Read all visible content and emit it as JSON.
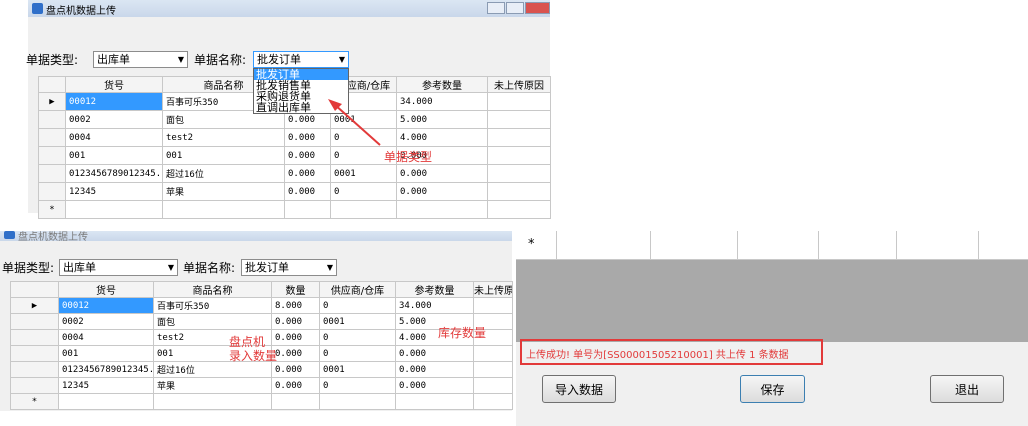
{
  "window": {
    "title": "盘点机数据上传"
  },
  "top": {
    "type_label": "单据类型:",
    "type_value": "出库单",
    "name_label": "单据名称:",
    "name_value": "批发订单",
    "dropdown_options": [
      "批发订单",
      "批发销售单",
      "采购退货单",
      "直调出库单"
    ],
    "headers": [
      "货号",
      "商品名称",
      "",
      "供应商/仓库",
      "参考数量",
      "未上传原因"
    ],
    "rows": [
      [
        "00012",
        "百事可乐350",
        "",
        "",
        "34.000",
        ""
      ],
      [
        "0002",
        "面包",
        "0.000",
        "0001",
        "5.000",
        ""
      ],
      [
        "0004",
        "test2",
        "0.000",
        "0",
        "4.000",
        ""
      ],
      [
        "001",
        "001",
        "0.000",
        "0",
        "0.000",
        ""
      ],
      [
        "0123456789012345...",
        "超过16位",
        "0.000",
        "0001",
        "0.000",
        ""
      ],
      [
        "12345",
        "苹果",
        "0.000",
        "0",
        "0.000",
        ""
      ]
    ],
    "annotation": "单据类型"
  },
  "bottom": {
    "title": "盘点机数据上传",
    "type_label": "单据类型:",
    "type_value": "出库单",
    "name_label": "单据名称:",
    "name_value": "批发订单",
    "headers": [
      "货号",
      "商品名称",
      "数量",
      "供应商/仓库",
      "参考数量",
      "未上传原"
    ],
    "rows": [
      [
        "00012",
        "百事可乐350",
        "8.000",
        "0",
        "34.000",
        ""
      ],
      [
        "0002",
        "面包",
        "0.000",
        "0001",
        "5.000",
        ""
      ],
      [
        "0004",
        "test2",
        "0.000",
        "0",
        "4.000",
        ""
      ],
      [
        "001",
        "001",
        "0.000",
        "0",
        "0.000",
        ""
      ],
      [
        "0123456789012345...",
        "超过16位",
        "0.000",
        "0001",
        "0.000",
        ""
      ],
      [
        "12345",
        "苹果",
        "0.000",
        "0",
        "0.000",
        ""
      ]
    ],
    "annotation_count": "盘点机\n录入数量",
    "annotation_stock": "库存数量"
  },
  "right": {
    "new_row_marker": "*",
    "status": "上传成功! 单号为[SS00001505210001] 共上传 1 条数据",
    "import_button": "导入数据",
    "save_button": "保存",
    "exit_button": "退出"
  },
  "colors": {
    "annotation": "#e23a3a",
    "selection": "#3399ff"
  }
}
